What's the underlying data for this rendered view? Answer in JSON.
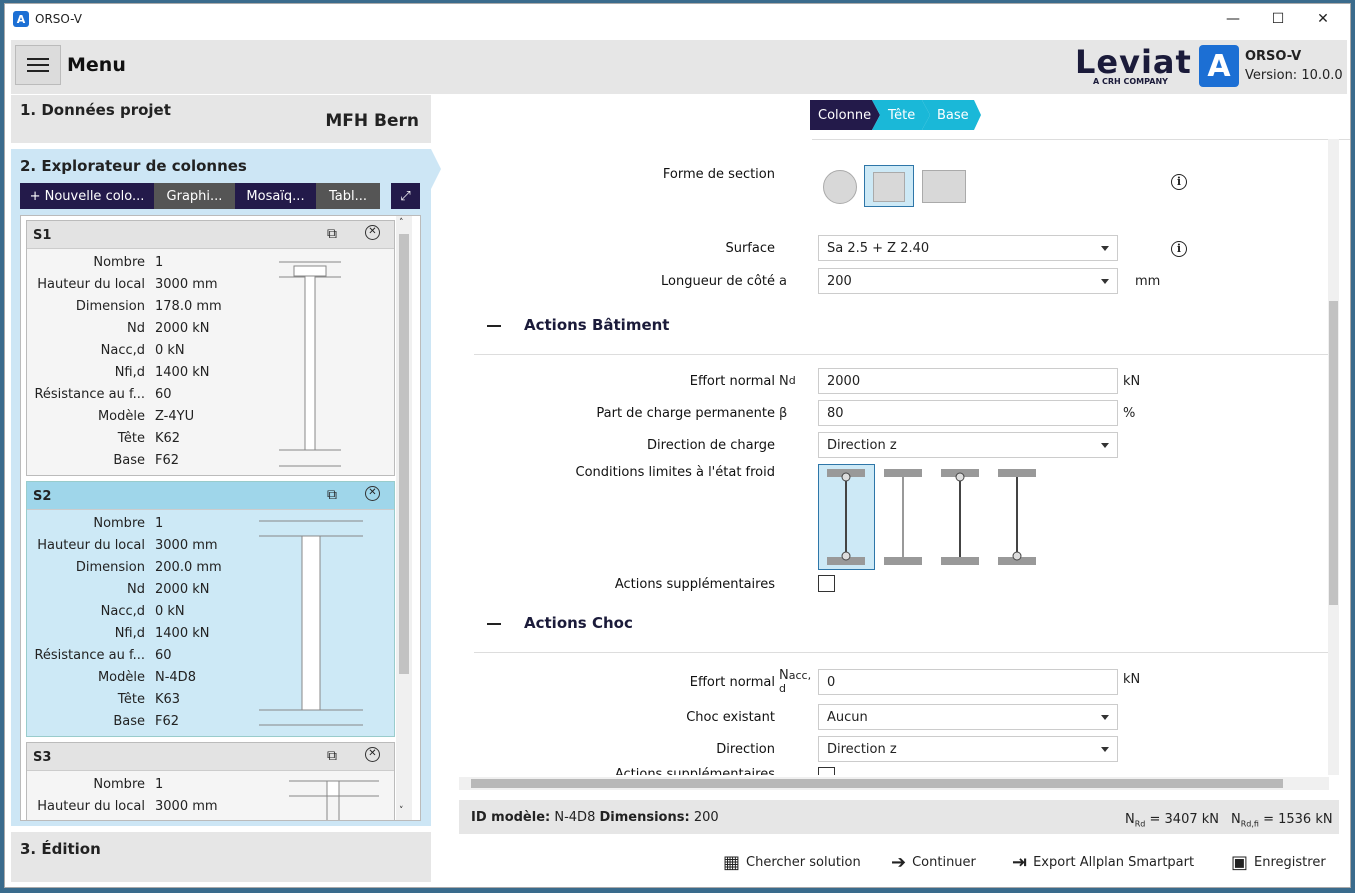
{
  "window": {
    "title": "ORSO-V",
    "minimize": "—",
    "maximize": "☐",
    "close": "✕"
  },
  "header": {
    "menu_label": "Menu",
    "brand": "Leviat",
    "brand_sub": "A CRH COMPANY",
    "app_logo": "A",
    "app_name": "ORSO-V",
    "version": "Version: 10.0.0"
  },
  "left": {
    "section1": {
      "title": "1. Données projet",
      "project": "MFH Bern"
    },
    "section2": {
      "title": "2. Explorateur de colonnes",
      "toolbar": [
        "+ Nouvelle colo...",
        "Graphi...",
        "Mosaïq...",
        "Tabl..."
      ],
      "expand_icon": "⤢",
      "cards": [
        {
          "name": "S1",
          "rows": [
            [
              "Nombre",
              "1"
            ],
            [
              "Hauteur du local",
              "3000 mm"
            ],
            [
              "Dimension",
              "178.0 mm"
            ],
            [
              "Nd",
              "2000 kN"
            ],
            [
              "Nacc,d",
              "0 kN"
            ],
            [
              "Nfi,d",
              "1400 kN"
            ],
            [
              "Résistance au f...",
              "60"
            ],
            [
              "Modèle",
              "Z-4YU"
            ],
            [
              "Tête",
              "K62"
            ],
            [
              "Base",
              "F62"
            ]
          ]
        },
        {
          "name": "S2",
          "rows": [
            [
              "Nombre",
              "1"
            ],
            [
              "Hauteur du local",
              "3000 mm"
            ],
            [
              "Dimension",
              "200.0 mm"
            ],
            [
              "Nd",
              "2000 kN"
            ],
            [
              "Nacc,d",
              "0 kN"
            ],
            [
              "Nfi,d",
              "1400 kN"
            ],
            [
              "Résistance au f...",
              "60"
            ],
            [
              "Modèle",
              "N-4D8"
            ],
            [
              "Tête",
              "K63"
            ],
            [
              "Base",
              "F62"
            ]
          ]
        },
        {
          "name": "S3",
          "rows": [
            [
              "Nombre",
              "1"
            ],
            [
              "Hauteur du local",
              "3000 mm"
            ]
          ]
        }
      ]
    },
    "section3": {
      "title": "3. Édition"
    }
  },
  "main": {
    "crumbs": [
      "Colonne",
      "Tête",
      "Base"
    ],
    "forme_label": "Forme de section",
    "surface": {
      "label": "Surface",
      "value": "Sa 2.5 + Z 2.40"
    },
    "longueur": {
      "label": "Longueur de côté",
      "sym": "a",
      "value": "200",
      "unit": "mm"
    },
    "actions_batiment": {
      "title": "Actions Bâtiment",
      "effort": {
        "label": "Effort normal",
        "sym": "N",
        "sub": "d",
        "value": "2000",
        "unit": "kN"
      },
      "part": {
        "label": "Part de charge permanente",
        "sym": "β",
        "value": "80",
        "unit": "%"
      },
      "direction": {
        "label": "Direction de charge",
        "value": "Direction z"
      },
      "conditions": {
        "label": "Conditions limites à l'état froid"
      },
      "supp": {
        "label": "Actions supplémentaires"
      }
    },
    "actions_choc": {
      "title": "Actions Choc",
      "effort": {
        "label": "Effort normal",
        "sym": "N",
        "sub": "acc,",
        "sub2": "d",
        "value": "0",
        "unit": "kN"
      },
      "choc": {
        "label": "Choc existant",
        "value": "Aucun"
      },
      "direction": {
        "label": "Direction",
        "value": "Direction z"
      },
      "supp": {
        "label": "Actions supplémentaires"
      }
    }
  },
  "status": {
    "id_label": "ID modèle:",
    "id_value": "N-4D8",
    "dim_label": "Dimensions:",
    "dim_value": "200",
    "nrd_sym": "N",
    "nrd_sub": "Rd",
    "nrd_val": "= 3407 kN",
    "nrdfi_sym": "N",
    "nrdfi_sub": "Rd,fi",
    "nrdfi_val": "= 1536 kN"
  },
  "footer": {
    "search": "Chercher solution",
    "continue": "Continuer",
    "export": "Export Allplan Smartpart",
    "save": "Enregistrer"
  },
  "colors": {
    "navy": "#231a4a",
    "cyan": "#1ab8d8",
    "selected": "#cde6f5"
  }
}
